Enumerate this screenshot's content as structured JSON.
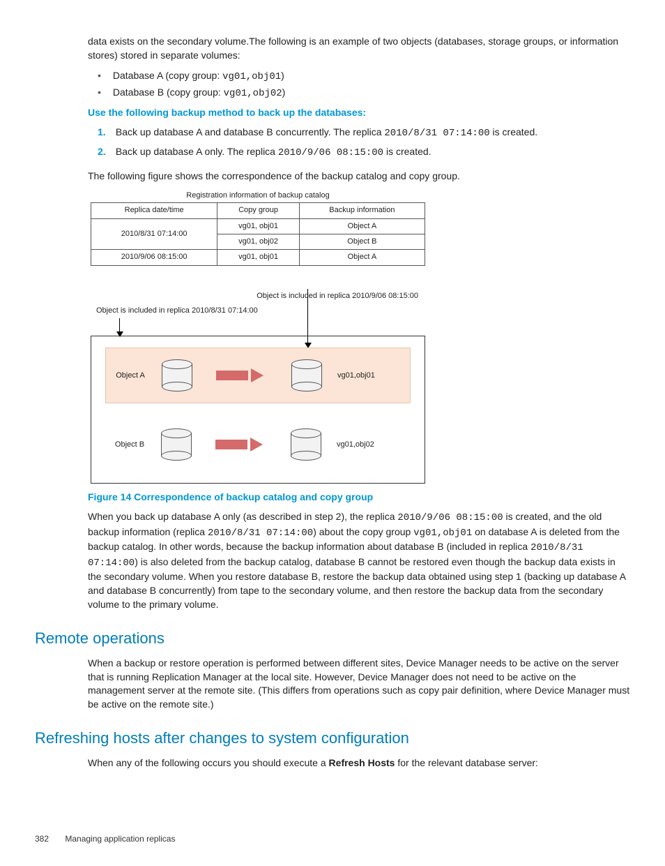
{
  "intro": "data exists on the secondary volume.The following is an example of two objects (databases, storage groups, or information stores) stored in separate volumes:",
  "bullets": {
    "a_pre": "Database A (copy group: ",
    "a_code": "vg01,obj01",
    "a_post": ")",
    "b_pre": "Database B (copy group: ",
    "b_code": "vg01,obj02",
    "b_post": ")"
  },
  "method_heading": "Use the following backup method to back up the databases:",
  "steps": {
    "n1": "1.",
    "s1a": "Back up database A and database B concurrently. The replica ",
    "s1b": "2010/8/31 07:14:00",
    "s1c": " is created.",
    "n2": "2.",
    "s2a": "Back up database A only. The replica ",
    "s2b": "2010/9/06 08:15:00",
    "s2c": " is created."
  },
  "after_steps": "The following figure shows the correspondence of the backup catalog and copy group.",
  "fig": {
    "reg_title": "Registration information of backup catalog",
    "h1": "Replica date/time",
    "h2": "Copy group",
    "h3": "Backup information",
    "r1c1": "2010/8/31 07:14:00",
    "r1c2": "vg01, obj01",
    "r1c3": "Object  A",
    "r2c1": "",
    "r2c2": "vg01, obj02",
    "r2c3": "Object  B",
    "r3c1": "2010/9/06 08:15:00",
    "r3c2": "vg01, obj01",
    "r3c3": "Object  A",
    "note_right": "Object is included in replica 2010/9/06 08:15:00",
    "note_left": "Object is included in replica 2010/8/31 07:14:00",
    "objA": "Object  A",
    "objB": "Object  B",
    "cg1": "vg01,obj01",
    "cg2": "vg01,obj02"
  },
  "fig_caption": "Figure 14 Correspondence of backup catalog and copy group",
  "para2": {
    "t1": "When you back up database A only (as described in step 2), the replica ",
    "c1": "2010/9/06 08:15:00",
    "t2": " is created, and the old backup information (replica ",
    "c2": "2010/8/31 07:14:00",
    "t3": ") about the copy group ",
    "c3": "vg01,obj01",
    "t4": " on database A is deleted from the backup catalog. In other words, because the backup information about database B (included in replica ",
    "c4": "2010/8/31 07:14:00",
    "t5": ") is also deleted from the backup catalog, database B cannot be restored even though the backup data exists in the secondary volume. When you restore database B, restore the backup data obtained using step 1 (backing up database A and database B concurrently) from tape to the secondary volume, and then restore the backup data from the secondary volume to the primary volume."
  },
  "h_remote": "Remote operations",
  "remote_body": "When a backup or restore operation is performed between different sites, Device Manager needs to be active on the server that is running Replication Manager at the local site. However, Device Manager does not need to be active on the management server at the remote site. (This differs from operations such as copy pair definition, where Device Manager must be active on the remote site.)",
  "h_refresh": "Refreshing hosts after changes to system configuration",
  "refresh_body_a": "When any of the following occurs you should execute a ",
  "refresh_bold": "Refresh Hosts",
  "refresh_body_b": " for the relevant database server:",
  "footer_page": "382",
  "footer_title": "Managing application replicas"
}
